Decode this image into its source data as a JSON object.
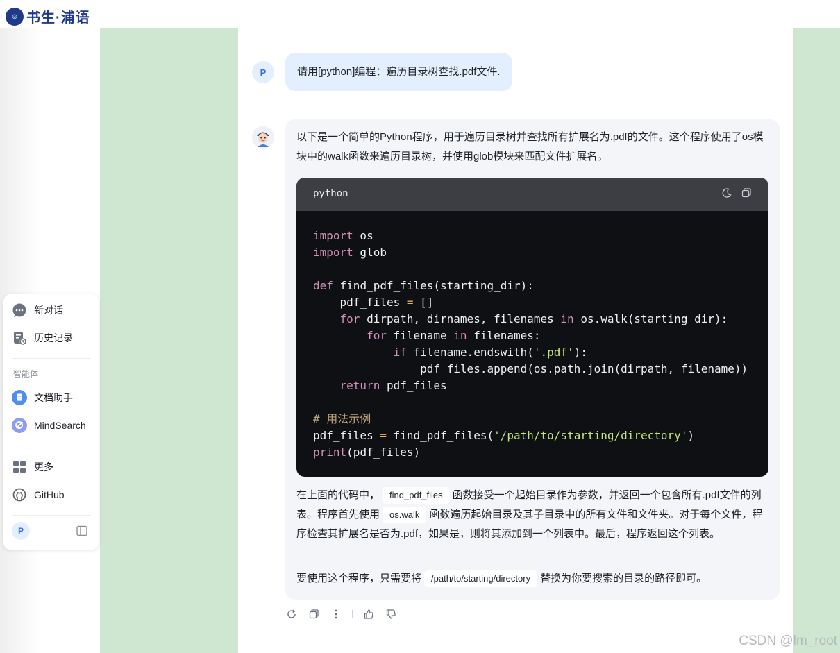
{
  "brand": {
    "name": "书生·浦语"
  },
  "sidebar": {
    "items": [
      {
        "label": "新对话",
        "icon": "chat-bubble-icon"
      },
      {
        "label": "历史记录",
        "icon": "history-icon"
      }
    ],
    "agents_title": "智能体",
    "agents": [
      {
        "label": "文档助手",
        "icon": "document-assistant-icon"
      },
      {
        "label": "MindSearch",
        "icon": "mindsearch-icon"
      }
    ],
    "more": [
      {
        "label": "更多",
        "icon": "grid-icon"
      },
      {
        "label": "GitHub",
        "icon": "github-icon"
      }
    ],
    "user_avatar": "P"
  },
  "conversation": {
    "user": {
      "avatar": "P",
      "message": "请用[python]编程：遍历目录树查找.pdf文件."
    },
    "assistant": {
      "intro": "以下是一个简单的Python程序，用于遍历目录树并查找所有扩展名为.pdf的文件。这个程序使用了os模块中的walk函数来遍历目录树，并使用glob模块来匹配文件扩展名。",
      "code": {
        "language": "python",
        "lines": [
          [
            {
              "t": "import",
              "c": "kw"
            },
            {
              "t": " os",
              "c": ""
            }
          ],
          [
            {
              "t": "import",
              "c": "kw"
            },
            {
              "t": " glob",
              "c": ""
            }
          ],
          [],
          [
            {
              "t": "def",
              "c": "kw"
            },
            {
              "t": " find_pdf_files(starting_dir):",
              "c": ""
            }
          ],
          [
            {
              "t": "    pdf_files ",
              "c": ""
            },
            {
              "t": "=",
              "c": "op"
            },
            {
              "t": " []",
              "c": ""
            }
          ],
          [
            {
              "t": "    ",
              "c": ""
            },
            {
              "t": "for",
              "c": "kw"
            },
            {
              "t": " dirpath, dirnames, filenames ",
              "c": ""
            },
            {
              "t": "in",
              "c": "kw"
            },
            {
              "t": " os.walk(starting_dir):",
              "c": ""
            }
          ],
          [
            {
              "t": "        ",
              "c": ""
            },
            {
              "t": "for",
              "c": "kw"
            },
            {
              "t": " filename ",
              "c": ""
            },
            {
              "t": "in",
              "c": "kw"
            },
            {
              "t": " filenames:",
              "c": ""
            }
          ],
          [
            {
              "t": "            ",
              "c": ""
            },
            {
              "t": "if",
              "c": "kw"
            },
            {
              "t": " filename.endswith(",
              "c": ""
            },
            {
              "t": "'.pdf'",
              "c": "st"
            },
            {
              "t": "):",
              "c": ""
            }
          ],
          [
            {
              "t": "                pdf_files.append(os.path.join(dirpath, filename))",
              "c": ""
            }
          ],
          [
            {
              "t": "    ",
              "c": ""
            },
            {
              "t": "return",
              "c": "kw"
            },
            {
              "t": " pdf_files",
              "c": ""
            }
          ],
          [],
          [
            {
              "t": "# 用法示例",
              "c": "cm"
            }
          ],
          [
            {
              "t": "pdf_files ",
              "c": ""
            },
            {
              "t": "=",
              "c": "op"
            },
            {
              "t": " find_pdf_files(",
              "c": ""
            },
            {
              "t": "'/path/to/starting/directory'",
              "c": "st"
            },
            {
              "t": ")",
              "c": ""
            }
          ],
          [
            {
              "t": "print",
              "c": "kw"
            },
            {
              "t": "(pdf_files)",
              "c": ""
            }
          ]
        ]
      },
      "explanation": {
        "p1_a": "在上面的代码中，",
        "p1_code1": "find_pdf_files",
        "p1_b": "函数接受一个起始目录作为参数，并返回一个包含所有.pdf文件的列表。程序首先使用",
        "p1_code2": "os.walk",
        "p1_c": "函数遍历起始目录及其子目录中的所有文件和文件夹。对于每个文件，程序检查其扩展名是否为.pdf，如果是，则将其添加到一个列表中。最后，程序返回这个列表。",
        "p2_a": "要使用这个程序，只需要将",
        "p2_code": "/path/to/starting/directory",
        "p2_b": "替换为你要搜索的目录的路径即可。"
      }
    }
  },
  "watermark": "CSDN @lm_root",
  "colors": {
    "accent": "#3a6fd8",
    "user_bubble": "#e3efff",
    "green_panel": "#cfe6d0",
    "code_bg": "#0e1014"
  }
}
